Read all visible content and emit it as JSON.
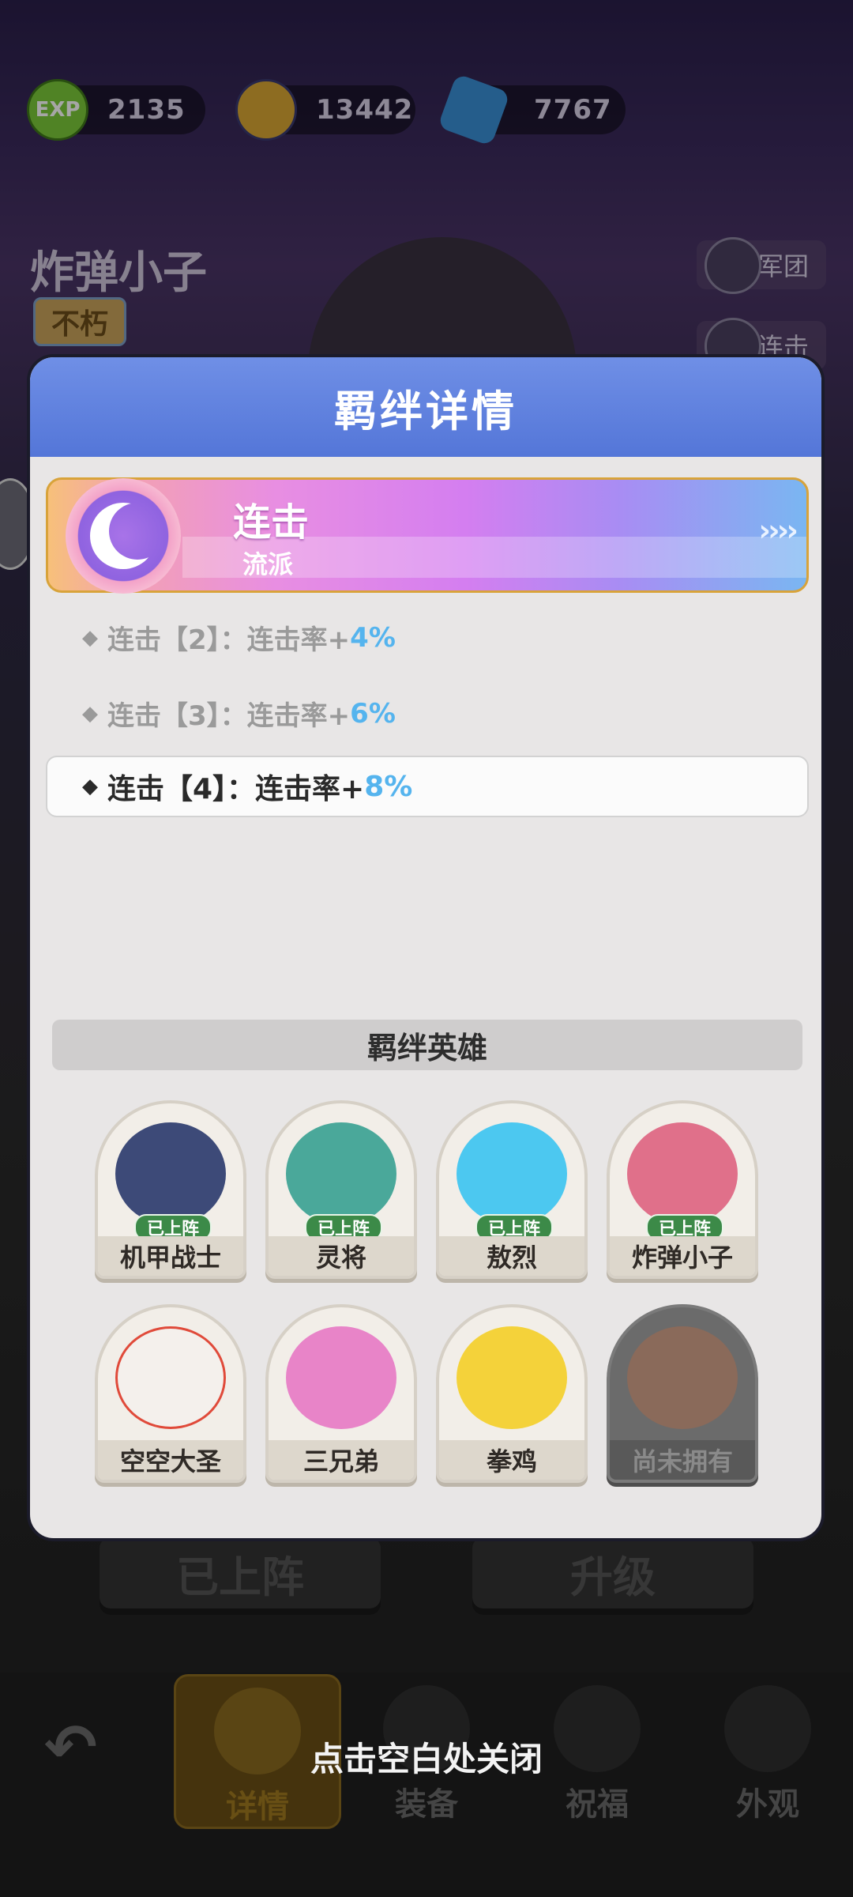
{
  "resources": [
    {
      "icon": "exp-icon",
      "icon_text": "EXP",
      "value": "2135",
      "color": "#7cc93a"
    },
    {
      "icon": "coin-icon",
      "icon_text": "",
      "value": "13442",
      "color": "#d9a633"
    },
    {
      "icon": "gem-icon",
      "icon_text": "",
      "value": "7767",
      "color": "#3a8fd6"
    }
  ],
  "hero": {
    "name": "炸弹小子",
    "rank": "不朽"
  },
  "side_buttons": {
    "legion": "军团",
    "combo": "连击"
  },
  "background_buttons": {
    "deployed": "已上阵",
    "upgrade": "升级"
  },
  "bottom_nav": [
    {
      "label": "详情",
      "icon": "helmet-icon",
      "active": true
    },
    {
      "label": "装备",
      "icon": "sword-icon",
      "active": false
    },
    {
      "label": "祝福",
      "icon": "star-icon",
      "active": false
    },
    {
      "label": "外观",
      "icon": "cloak-icon",
      "active": false
    }
  ],
  "close_hint": "点击空白处关闭",
  "modal": {
    "title": "羁绊详情",
    "faction": {
      "name": "连击",
      "type": "流派",
      "arrows": "››››"
    },
    "bonuses": [
      {
        "prefix": "连击【2】：连击率+",
        "value": "4%",
        "active": false
      },
      {
        "prefix": "连击【3】：连击率+",
        "value": "6%",
        "active": false
      },
      {
        "prefix": "连击【4】：连击率+",
        "value": "8%",
        "active": true
      }
    ],
    "heroes_title": "羁绊英雄",
    "deployed_badge": "已上阵",
    "heroes": [
      {
        "name": "机甲战士",
        "deployed": true,
        "owned": true,
        "color": "#3d4a78"
      },
      {
        "name": "灵将",
        "deployed": true,
        "owned": true,
        "color": "#4aa89a"
      },
      {
        "name": "敖烈",
        "deployed": true,
        "owned": true,
        "color": "#4cc8f0"
      },
      {
        "name": "炸弹小子",
        "deployed": true,
        "owned": true,
        "color": "#e0708a"
      },
      {
        "name": "空空大圣",
        "deployed": false,
        "owned": true,
        "color": "#f4f0ec"
      },
      {
        "name": "三兄弟",
        "deployed": false,
        "owned": true,
        "color": "#e884c8"
      },
      {
        "name": "拳鸡",
        "deployed": false,
        "owned": true,
        "color": "#f4d23a"
      },
      {
        "name": "尚未拥有",
        "deployed": false,
        "owned": false,
        "color": "#8a6a5a"
      }
    ]
  }
}
